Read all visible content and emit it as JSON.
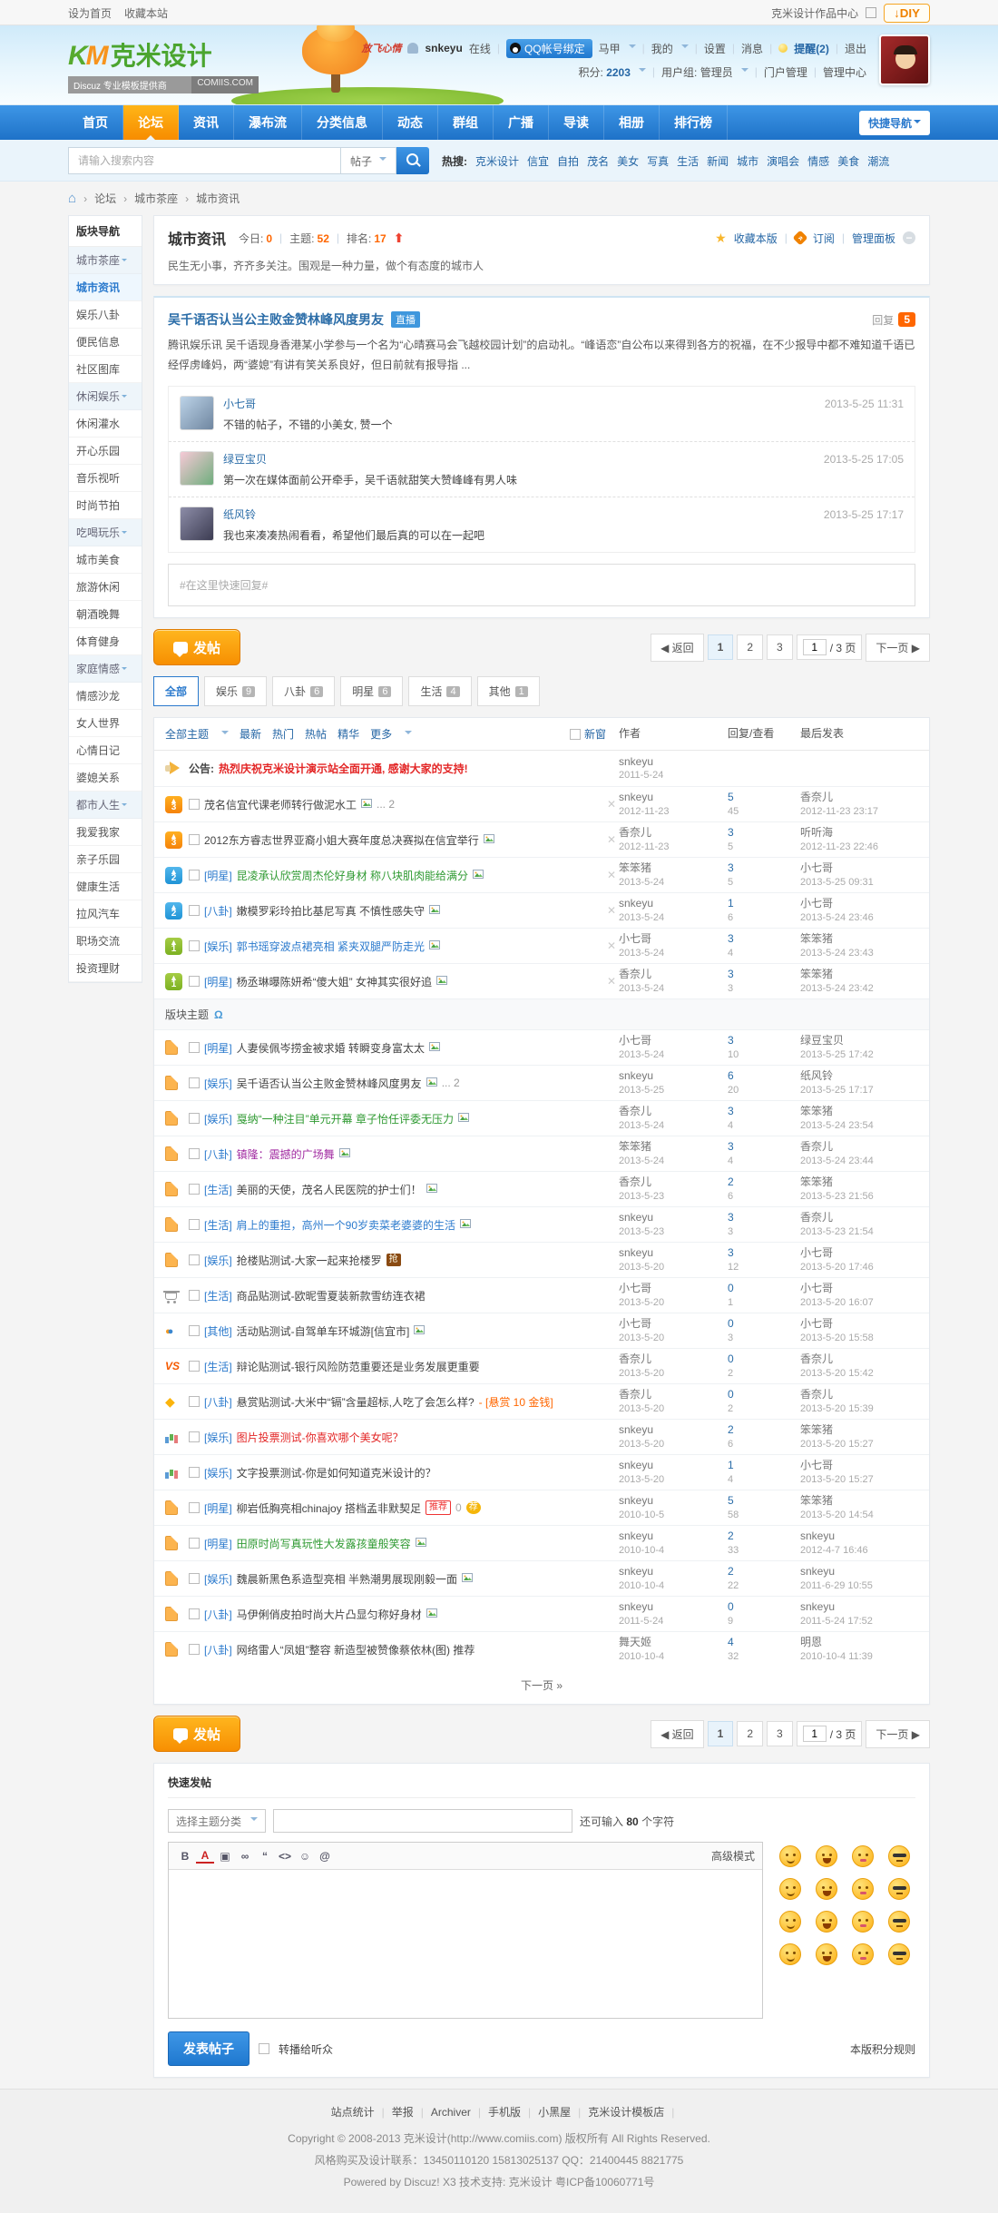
{
  "topbar": {
    "left": [
      "设为首页",
      "收藏本站"
    ],
    "right_text": "克米设计作品中心",
    "diy": "↓DIY"
  },
  "header": {
    "logo_mark": "K",
    "logo_mark2": "M",
    "logo_text": "克米设计",
    "logo_sub": "Discuz 专业模板提供商",
    "logo_domain": "COMIIS.COM",
    "deco": "放飞心情",
    "username": "snkeyu",
    "status": "在线",
    "qq": "QQ帐号绑定",
    "menu1": [
      "马甲",
      "我的",
      "设置",
      "消息"
    ],
    "remind": "提醒(2)",
    "logout": "退出",
    "credit_label": "积分:",
    "credit": "2203",
    "group_label": "用户组:",
    "group": "管理员",
    "portal": "门户管理",
    "admin": "管理中心"
  },
  "nav": {
    "items": [
      {
        "label": "首页",
        "active": false
      },
      {
        "label": "论坛",
        "active": true
      },
      {
        "label": "资讯",
        "active": false
      },
      {
        "label": "瀑布流",
        "active": false
      },
      {
        "label": "分类信息",
        "active": false
      },
      {
        "label": "动态",
        "active": false
      },
      {
        "label": "群组",
        "active": false
      },
      {
        "label": "广播",
        "active": false
      },
      {
        "label": "导读",
        "active": false
      },
      {
        "label": "相册",
        "active": false
      },
      {
        "label": "排行榜",
        "active": false
      }
    ],
    "quick": "快捷导航"
  },
  "search": {
    "placeholder": "请输入搜索内容",
    "type": "帖子",
    "hot_label": "热搜:",
    "words": [
      "克米设计",
      "信宜",
      "自拍",
      "茂名",
      "美女",
      "写真",
      "生活",
      "新闻",
      "城市",
      "演唱会",
      "情感",
      "美食",
      "潮流"
    ]
  },
  "breadcrumb": [
    "论坛",
    "城市茶座",
    "城市资讯"
  ],
  "sidebar": {
    "title": "版块导航",
    "groups": [
      {
        "label": "城市茶座",
        "items": [
          {
            "label": "城市资讯",
            "active": true
          },
          {
            "label": "娱乐八卦",
            "active": false
          },
          {
            "label": "便民信息",
            "active": false
          },
          {
            "label": "社区图库",
            "active": false
          }
        ]
      },
      {
        "label": "休闲娱乐",
        "items": [
          {
            "label": "休闲灌水",
            "active": false
          },
          {
            "label": "开心乐园",
            "active": false
          },
          {
            "label": "音乐视听",
            "active": false
          },
          {
            "label": "时尚节拍",
            "active": false
          }
        ]
      },
      {
        "label": "吃喝玩乐",
        "items": [
          {
            "label": "城市美食",
            "active": false
          },
          {
            "label": "旅游休闲",
            "active": false
          },
          {
            "label": "朝酒晚舞",
            "active": false
          },
          {
            "label": "体育健身",
            "active": false
          }
        ]
      },
      {
        "label": "家庭情感",
        "items": [
          {
            "label": "情感沙龙",
            "active": false
          },
          {
            "label": "女人世界",
            "active": false
          },
          {
            "label": "心情日记",
            "active": false
          },
          {
            "label": "婆媳关系",
            "active": false
          }
        ]
      },
      {
        "label": "都市人生",
        "items": [
          {
            "label": "我爱我家",
            "active": false
          },
          {
            "label": "亲子乐园",
            "active": false
          },
          {
            "label": "健康生活",
            "active": false
          },
          {
            "label": "拉风汽车",
            "active": false
          },
          {
            "label": "职场交流",
            "active": false
          },
          {
            "label": "投资理财",
            "active": false
          }
        ]
      }
    ]
  },
  "forum": {
    "name": "城市资讯",
    "today_label": "今日:",
    "today": "0",
    "threads_label": "主题:",
    "threads": "52",
    "rank_label": "排名:",
    "rank": "17",
    "fav": "收藏本版",
    "sub": "订阅",
    "manage": "管理面板",
    "desc": "民生无小事，齐齐多关注。围观是一种力量，做个有态度的城市人"
  },
  "featured": {
    "title": "吴千语否认当公主败金赞林峰风度男友",
    "badge": "直播",
    "reply_label": "回复",
    "reply_count": "5",
    "excerpt": "腾讯娱乐讯 吴千语现身香港某小学参与一个名为“心晴赛马会飞越校园计划”的启动礼。“峰语恋”自公布以来得到各方的祝福，在不少报导中都不难知道千语已经俘虏峰妈，两“婆媳”有讲有笑关系良好，但日前就有报导指 ...",
    "replies": [
      {
        "name": "小七哥",
        "time": "2013-5-25 11:31",
        "text": "不错的帖子，不错的小美女, 赞一个"
      },
      {
        "name": "绿豆宝贝",
        "time": "2013-5-25 17:05",
        "text": "第一次在媒体面前公开牵手，吴千语就甜笑大赞峰峰有男人味"
      },
      {
        "name": "纸风铃",
        "time": "2013-5-25 17:17",
        "text": "我也来凑凑热闹看看，希望他们最后真的可以在一起吧"
      }
    ],
    "quick_reply": "#在这里快速回复#"
  },
  "pager": {
    "post": "发帖",
    "back": "◀ 返回",
    "pages": [
      "1",
      "2",
      "3"
    ],
    "current": "1",
    "total": "/ 3 页",
    "next": "下一页 ▶"
  },
  "tabs": [
    {
      "label": "全部",
      "count": "",
      "active": true
    },
    {
      "label": "娱乐",
      "count": "9",
      "active": false
    },
    {
      "label": "八卦",
      "count": "6",
      "active": false
    },
    {
      "label": "明星",
      "count": "6",
      "active": false
    },
    {
      "label": "生活",
      "count": "4",
      "active": false
    },
    {
      "label": "其他",
      "count": "1",
      "active": false
    }
  ],
  "filters": {
    "left": [
      "全部主题",
      "最新",
      "热门",
      "热帖",
      "精华",
      "更多"
    ],
    "newwin": "新窗",
    "author": "作者",
    "replies": "回复/查看",
    "last": "最后发表"
  },
  "announce": {
    "label": "公告:",
    "title": "热烈庆祝克米设计演示站全面开通, 感谢大家的支持!",
    "author": "snkeyu",
    "date": "2011-5-24"
  },
  "section_title": "版块主题",
  "sticky_threads": [
    {
      "level": 3,
      "cat": "",
      "title": "茂名信宜代课老师转行做泥水工",
      "color": "",
      "attach": true,
      "pages": " ... 2",
      "author": "snkeyu",
      "date": "2012-11-23",
      "replies": "5",
      "views": "45",
      "last_user": "香奈儿",
      "last_time": "2012-11-23 23:17"
    },
    {
      "level": 3,
      "cat": "",
      "title": "2012东方睿志世界亚裔小姐大赛年度总决赛拟在信宜举行",
      "color": "",
      "attach": true,
      "pages": "",
      "author": "香奈儿",
      "date": "2012-11-23",
      "replies": "3",
      "views": "5",
      "last_user": "听听海",
      "last_time": "2012-11-23 22:46"
    },
    {
      "level": 2,
      "cat": "明星",
      "title": "昆凌承认欣赏周杰伦好身材 称八块肌肉能给满分",
      "color": "green",
      "attach": true,
      "pages": "",
      "author": "笨笨猪",
      "date": "2013-5-24",
      "replies": "3",
      "views": "5",
      "last_user": "小七哥",
      "last_time": "2013-5-25 09:31"
    },
    {
      "level": 2,
      "cat": "八卦",
      "title": "嫩模罗彩玲拍比基尼写真 不慎性感失守",
      "color": "",
      "attach": true,
      "pages": "",
      "author": "snkeyu",
      "date": "2013-5-24",
      "replies": "1",
      "views": "6",
      "last_user": "小七哥",
      "last_time": "2013-5-24 23:46"
    },
    {
      "level": 1,
      "cat": "娱乐",
      "title": "郭书瑶穿波点裙亮相 紧夹双腿严防走光",
      "color": "blue",
      "attach": true,
      "pages": "",
      "author": "小七哥",
      "date": "2013-5-24",
      "replies": "3",
      "views": "4",
      "last_user": "笨笨猪",
      "last_time": "2013-5-24 23:43"
    },
    {
      "level": 1,
      "cat": "明星",
      "title": "杨丞琳曝陈妍希“傻大姐” 女神其实很好追",
      "color": "",
      "attach": true,
      "pages": "",
      "author": "香奈儿",
      "date": "2013-5-24",
      "replies": "3",
      "views": "3",
      "last_user": "笨笨猪",
      "last_time": "2013-5-24 23:42"
    }
  ],
  "threads": [
    {
      "icon": "doc",
      "cat": "明星",
      "title": "人妻侯佩岑捞金被求婚 转瞬变身富太太",
      "color": "",
      "attach": true,
      "pages": "",
      "suffix": "",
      "badges": [],
      "author": "小七哥",
      "date": "2013-5-24",
      "replies": "3",
      "views": "10",
      "last_user": "绿豆宝贝",
      "last_time": "2013-5-25 17:42"
    },
    {
      "icon": "doc",
      "cat": "娱乐",
      "title": "吴千语否认当公主败金赞林峰风度男友",
      "color": "",
      "attach": true,
      "pages": " ... 2",
      "suffix": "",
      "badges": [],
      "author": "snkeyu",
      "date": "2013-5-25",
      "replies": "6",
      "views": "20",
      "last_user": "纸风铃",
      "last_time": "2013-5-25 17:17"
    },
    {
      "icon": "doc",
      "cat": "娱乐",
      "title": "戛纳“一种注目”单元开幕 章子怡任评委无压力",
      "color": "green",
      "attach": true,
      "pages": "",
      "suffix": "",
      "badges": [],
      "author": "香奈儿",
      "date": "2013-5-24",
      "replies": "3",
      "views": "4",
      "last_user": "笨笨猪",
      "last_time": "2013-5-24 23:54"
    },
    {
      "icon": "doc",
      "cat": "八卦",
      "title": "镇隆：震撼的广场舞",
      "color": "purple",
      "attach": true,
      "pages": "",
      "suffix": "",
      "badges": [],
      "author": "笨笨猪",
      "date": "2013-5-24",
      "replies": "3",
      "views": "4",
      "last_user": "香奈儿",
      "last_time": "2013-5-24 23:44"
    },
    {
      "icon": "doc",
      "cat": "生活",
      "title": "美丽的天使，茂名人民医院的护士们！",
      "color": "",
      "attach": true,
      "pages": "",
      "suffix": "",
      "badges": [],
      "author": "香奈儿",
      "date": "2013-5-23",
      "replies": "2",
      "views": "6",
      "last_user": "笨笨猪",
      "last_time": "2013-5-23 21:56"
    },
    {
      "icon": "doc",
      "cat": "生活",
      "title": "肩上的重担，高州一个90岁卖菜老婆婆的生活",
      "color": "blue",
      "attach": true,
      "pages": "",
      "suffix": "",
      "badges": [],
      "author": "snkeyu",
      "date": "2013-5-23",
      "replies": "3",
      "views": "3",
      "last_user": "香奈儿",
      "last_time": "2013-5-23 21:54"
    },
    {
      "icon": "doc",
      "cat": "娱乐",
      "title": "抢楼贴测试-大家一起来抢楼罗",
      "color": "",
      "attach": false,
      "pages": "",
      "suffix": "",
      "badges": [
        "抢"
      ],
      "author": "snkeyu",
      "date": "2013-5-20",
      "replies": "3",
      "views": "12",
      "last_user": "小七哥",
      "last_time": "2013-5-20 17:46"
    },
    {
      "icon": "cart",
      "cat": "生活",
      "title": "商品贴测试-欧昵雪夏装新款雪纺连衣裙",
      "color": "",
      "attach": false,
      "pages": "",
      "suffix": "",
      "badges": [],
      "author": "小七哥",
      "date": "2013-5-20",
      "replies": "0",
      "views": "1",
      "last_user": "小七哥",
      "last_time": "2013-5-20 16:07"
    },
    {
      "icon": "users",
      "cat": "其他",
      "title": "活动贴测试-自驾单车环城游[信宜市]",
      "color": "",
      "attach": true,
      "pages": "",
      "suffix": "",
      "badges": [],
      "author": "小七哥",
      "date": "2013-5-20",
      "replies": "0",
      "views": "3",
      "last_user": "小七哥",
      "last_time": "2013-5-20 15:58"
    },
    {
      "icon": "vs",
      "cat": "生活",
      "title": "辩论贴测试-银行风险防范重要还是业务发展更重要",
      "color": "",
      "attach": false,
      "pages": "",
      "suffix": "",
      "badges": [],
      "author": "香奈儿",
      "date": "2013-5-20",
      "replies": "0",
      "views": "2",
      "last_user": "香奈儿",
      "last_time": "2013-5-20 15:42"
    },
    {
      "icon": "gem",
      "cat": "八卦",
      "title": "悬赏贴测试-大米中“镉”含量超标,人吃了会怎么样?",
      "color": "",
      "attach": false,
      "pages": "",
      "suffix": " - [悬赏 10 金钱]",
      "badges": [],
      "author": "香奈儿",
      "date": "2013-5-20",
      "replies": "0",
      "views": "2",
      "last_user": "香奈儿",
      "last_time": "2013-5-20 15:39"
    },
    {
      "icon": "poll",
      "cat": "娱乐",
      "title": "图片投票测试-你喜欢哪个美女呢？",
      "color": "red",
      "attach": false,
      "pages": "",
      "suffix": "",
      "badges": [],
      "author": "snkeyu",
      "date": "2013-5-20",
      "replies": "2",
      "views": "6",
      "last_user": "笨笨猪",
      "last_time": "2013-5-20 15:27"
    },
    {
      "icon": "poll",
      "cat": "娱乐",
      "title": "文字投票测试-你是如何知道克米设计的？",
      "color": "",
      "attach": false,
      "pages": "",
      "suffix": "",
      "badges": [],
      "author": "snkeyu",
      "date": "2013-5-20",
      "replies": "1",
      "views": "4",
      "last_user": "小七哥",
      "last_time": "2013-5-20 15:27"
    },
    {
      "icon": "doc",
      "cat": "明星",
      "title": "柳岩低胸亮相chinajoy 搭档孟非默契足",
      "color": "",
      "attach": false,
      "pages": "",
      "suffix": "",
      "badges": [
        "推荐",
        "0",
        "荐"
      ],
      "author": "snkeyu",
      "date": "2010-10-5",
      "replies": "5",
      "views": "58",
      "last_user": "笨笨猪",
      "last_time": "2013-5-20 14:54"
    },
    {
      "icon": "doc",
      "cat": "明星",
      "title": "田原时尚写真玩性大发露孩童般笑容",
      "color": "green",
      "attach": true,
      "pages": "",
      "suffix": "",
      "badges": [],
      "author": "snkeyu",
      "date": "2010-10-4",
      "replies": "2",
      "views": "33",
      "last_user": "snkeyu",
      "last_time": "2012-4-7 16:46"
    },
    {
      "icon": "doc",
      "cat": "娱乐",
      "title": "魏晨新黑色系造型亮相 半熟潮男展现刚毅一面",
      "color": "",
      "attach": true,
      "pages": "",
      "suffix": "",
      "badges": [],
      "author": "snkeyu",
      "date": "2010-10-4",
      "replies": "2",
      "views": "22",
      "last_user": "snkeyu",
      "last_time": "2011-6-29 10:55"
    },
    {
      "icon": "doc",
      "cat": "八卦",
      "title": "马伊俐俏皮拍时尚大片凸显匀称好身材",
      "color": "",
      "attach": true,
      "pages": "",
      "suffix": "",
      "badges": [],
      "author": "snkeyu",
      "date": "2011-5-24",
      "replies": "0",
      "views": "9",
      "last_user": "snkeyu",
      "last_time": "2011-5-24 17:52"
    },
    {
      "icon": "doc",
      "cat": "八卦",
      "title": "网络雷人“凤姐”整容 新造型被赞像蔡依林(图) 推荐",
      "color": "",
      "attach": false,
      "pages": "",
      "suffix": "",
      "badges": [],
      "author": "舞天姬",
      "date": "2010-10-4",
      "replies": "4",
      "views": "32",
      "last_user": "明恩",
      "last_time": "2010-10-4 11:39"
    }
  ],
  "nextpage": "下一页 »",
  "quickpost": {
    "title": "快速发帖",
    "category": "选择主题分类",
    "counter_pre": "还可输入",
    "counter_num": "80",
    "counter_post": "个字符",
    "advanced": "高级模式",
    "toolbar": [
      {
        "name": "bold",
        "glyph": "B"
      },
      {
        "name": "color",
        "glyph": "A"
      },
      {
        "name": "image",
        "glyph": "▣"
      },
      {
        "name": "link",
        "glyph": "∞"
      },
      {
        "name": "quote",
        "glyph": "“"
      },
      {
        "name": "code",
        "glyph": "<>"
      },
      {
        "name": "smiley",
        "glyph": "☺"
      },
      {
        "name": "at",
        "glyph": "@"
      }
    ],
    "submit": "发表帖子",
    "broadcast": "转播给听众",
    "rules": "本版积分规则"
  },
  "smilies": [
    "smile",
    "laugh",
    "love",
    "cool",
    "blush",
    "shout",
    "sleep",
    "surprise",
    "tongue",
    "doubt",
    "cry-laugh",
    "grin",
    "happy",
    "shy",
    "angry",
    "cry"
  ],
  "footer": {
    "links": [
      "站点统计",
      "举报",
      "Archiver",
      "手机版",
      "小黑屋",
      "克米设计模板店"
    ],
    "line1": "Copyright © 2008-2013 克米设计(http://www.comiis.com) 版权所有 All Rights Reserved.",
    "line2": "风格购买及设计联系：13450110120 15813025137 QQ：21400445 8821775",
    "line3": "Powered by Discuz! X3  技术支持: 克米设计 粤ICP备10060771号"
  }
}
